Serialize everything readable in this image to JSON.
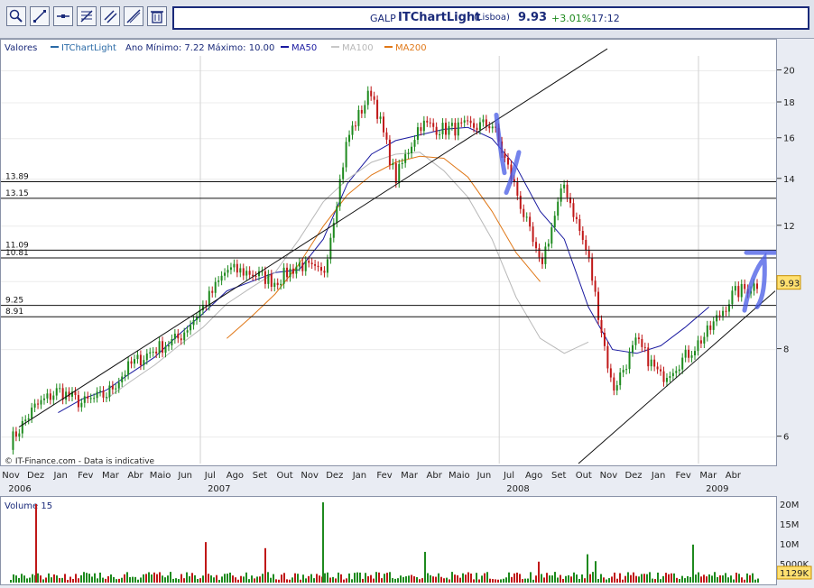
{
  "ticker": {
    "symbol": "GALP",
    "app": "ITChartLight",
    "exchange": "(Lisboa)",
    "price": "9.93",
    "change": "+3.01%",
    "time": "17:12"
  },
  "legend": {
    "prefix": "Valores",
    "items": [
      {
        "label": "ITChartLight",
        "color": "#2a6aa6"
      },
      {
        "label": "Ano Mínimo: 7.22 Máximo: 10.00",
        "color": null
      },
      {
        "label": "MA50",
        "color": "#1a1aa0"
      },
      {
        "label": "MA100",
        "color": "#b8b8b8"
      },
      {
        "label": "MA200",
        "color": "#e07818"
      }
    ]
  },
  "watermark": "© IT-Finance.com - Data is indicative",
  "chart_data": {
    "type": "candlestick",
    "x": [
      "2006-11",
      "2009-04"
    ],
    "ylim": [
      5.5,
      21
    ],
    "y_scale": "log",
    "y_ticks": [
      6,
      8,
      10,
      12,
      14,
      16,
      18,
      20
    ],
    "price_levels": [
      13.89,
      13.15,
      11.09,
      10.81,
      9.25,
      8.91
    ],
    "last_price": 9.93,
    "months": [
      "Nov",
      "Dez",
      "Jan",
      "Fev",
      "Mar",
      "Abr",
      "Maio",
      "Jun",
      "Jul",
      "Ago",
      "Set",
      "Out",
      "Nov",
      "Dez",
      "Jan",
      "Fev",
      "Mar",
      "Abr",
      "Maio",
      "Jun",
      "Jul",
      "Ago",
      "Set",
      "Out",
      "Nov",
      "Dez",
      "Jan",
      "Fev",
      "Mar",
      "Abr"
    ],
    "years": [
      {
        "label": "2006",
        "month_index": 0
      },
      {
        "label": "2007",
        "month_index": 8
      },
      {
        "label": "2008",
        "month_index": 20
      },
      {
        "label": "2009",
        "month_index": 28
      }
    ],
    "series": [
      {
        "name": "ITChartLight",
        "color": "#1e8a1e",
        "down_color": "#c01818",
        "values": [
          5.9,
          6.6,
          7.0,
          6.7,
          6.9,
          7.6,
          8.0,
          8.3,
          9.2,
          10.4,
          10.3,
          10.0,
          10.6,
          10.2,
          16.0,
          18.8,
          14.0,
          16.8,
          16.5,
          16.6,
          16.8,
          13.5,
          10.5,
          13.8,
          10.8,
          7.0,
          8.2,
          7.3,
          7.8,
          8.5,
          9.6,
          9.93
        ]
      },
      {
        "name": "MA50",
        "color": "#1a1aa0",
        "values": [
          null,
          null,
          6.5,
          6.8,
          7.0,
          7.4,
          7.8,
          8.4,
          9.0,
          9.7,
          10.0,
          10.3,
          10.4,
          11.5,
          13.8,
          15.2,
          15.9,
          16.2,
          16.5,
          16.6,
          16.0,
          14.6,
          12.6,
          11.5,
          9.2,
          8.0,
          7.9,
          8.1,
          8.6,
          9.2
        ]
      },
      {
        "name": "MA100",
        "color": "#b8b8b8",
        "values": [
          null,
          null,
          null,
          null,
          6.8,
          7.2,
          7.6,
          8.1,
          8.6,
          9.3,
          9.8,
          10.3,
          11.5,
          13.0,
          14.0,
          14.8,
          15.2,
          15.3,
          14.4,
          13.2,
          11.5,
          9.5,
          8.3,
          7.9,
          8.2
        ]
      },
      {
        "name": "MA200",
        "color": "#e07818",
        "values": [
          null,
          null,
          null,
          null,
          null,
          null,
          null,
          null,
          null,
          8.3,
          8.9,
          9.6,
          10.6,
          12.0,
          13.3,
          14.2,
          14.8,
          15.1,
          15.0,
          14.1,
          12.6,
          11.0,
          10.0
        ]
      }
    ],
    "volume": {
      "label": "Volume 15",
      "ticks": [
        "20M",
        "15M",
        "10M",
        "5000K"
      ],
      "last": "1129K"
    }
  }
}
